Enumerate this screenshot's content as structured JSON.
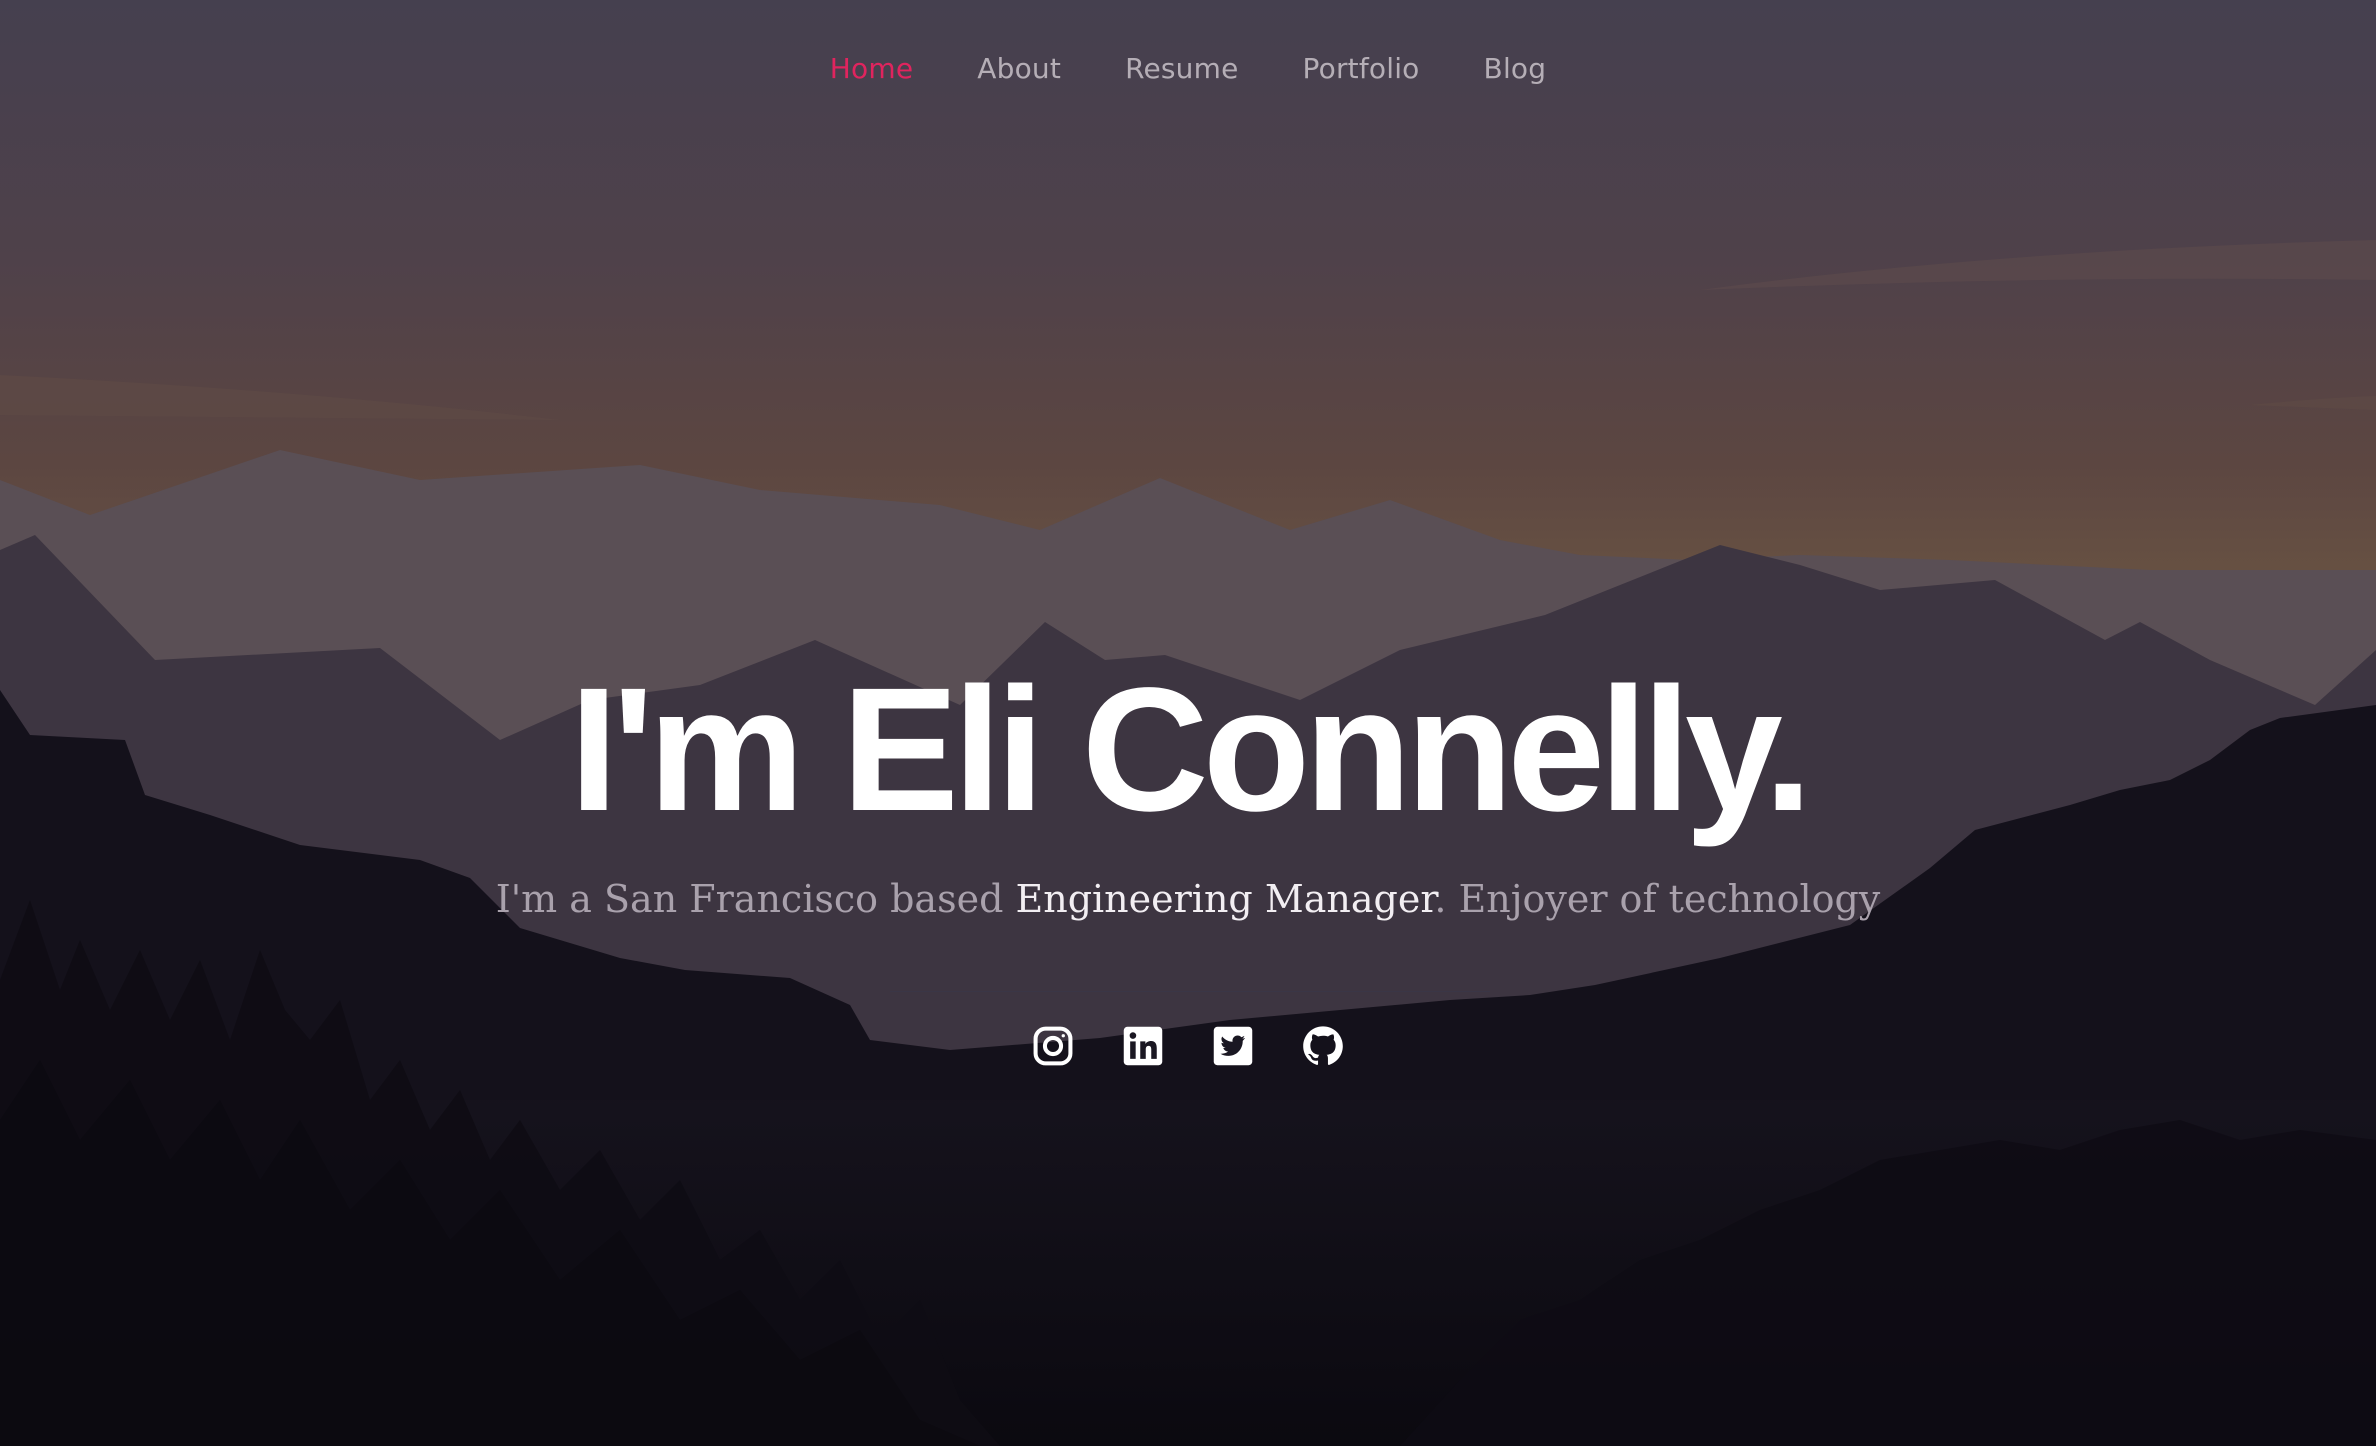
{
  "colors": {
    "accent": "#e0245e",
    "nav_text": "#b5aeb6",
    "title": "#ffffff",
    "subtitle": "#a9a1ac",
    "subtitle_highlight": "#f2eef2"
  },
  "nav": {
    "items": [
      {
        "label": "Home",
        "active": true
      },
      {
        "label": "About",
        "active": false
      },
      {
        "label": "Resume",
        "active": false
      },
      {
        "label": "Portfolio",
        "active": false
      },
      {
        "label": "Blog",
        "active": false
      }
    ]
  },
  "hero": {
    "title": "I'm Eli Connelly.",
    "subtitle_prefix": "I'm a San Francisco based ",
    "subtitle_highlight": "Engineering Manager",
    "subtitle_suffix": ". Enjoyer of technology"
  },
  "socials": [
    {
      "icon": "instagram-icon"
    },
    {
      "icon": "linkedin-icon"
    },
    {
      "icon": "twitter-icon"
    },
    {
      "icon": "github-icon"
    }
  ]
}
